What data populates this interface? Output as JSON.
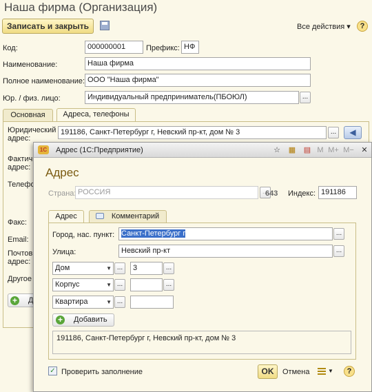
{
  "main": {
    "title": "Наша фирма (Организация)",
    "toolbar": {
      "save_close": "Записать и закрыть",
      "all_actions": "Все действия",
      "help": "?"
    },
    "fields": {
      "code_label": "Код:",
      "code_value": "000000001",
      "prefix_label": "Префикс:",
      "prefix_value": "НФ",
      "name_label": "Наименование:",
      "name_value": "Наша фирма",
      "fullname_label": "Полное наименование:",
      "fullname_value": "ООО \"Наша фирма\"",
      "legal_label": "Юр. / физ. лицо:",
      "legal_value": "Индивидуальный предприниматель(ПБОЮЛ)"
    },
    "tabs": [
      "Основная",
      "Адреса, телефоны"
    ],
    "address_rows": {
      "legal_label_1": "Юридический",
      "legal_label_2": "адрес:",
      "legal_value": "191186, Санкт-Петербург г, Невский пр-кт, дом № 3",
      "actual_label_1": "Фактич",
      "actual_label_2": "адрес:",
      "phone_label": "Телефо",
      "fax_label": "Факс:",
      "email_label": "Email:",
      "postal_label_1": "Почтов",
      "postal_label_2": "адрес:",
      "other_label": "Другое",
      "add_label": "Д"
    }
  },
  "dialog": {
    "window_title": "Адрес  (1С:Предприятие)",
    "tb_buttons": [
      "M",
      "M+",
      "M−"
    ],
    "heading": "Адрес",
    "country_label": "Страна:",
    "country_value": "РОССИЯ",
    "country_code": "643",
    "index_label": "Индекс:",
    "index_value": "191186",
    "tabs": [
      "Адрес",
      "Комментарий"
    ],
    "city_label": "Город, нас. пункт:",
    "city_value": "Санкт-Петербург г",
    "street_label": "Улица:",
    "street_value": "Невский пр-кт",
    "house_type": "Дом",
    "house_value": "3",
    "building_type": "Корпус",
    "building_value": "",
    "apartment_type": "Квартира",
    "apartment_value": "",
    "add_button": "Добавить",
    "full_address": "191186, Санкт-Петербург г, Невский пр-кт, дом № 3",
    "check_fill": "Проверить заполнение",
    "ok": "OK",
    "cancel": "Отмена",
    "help": "?"
  }
}
